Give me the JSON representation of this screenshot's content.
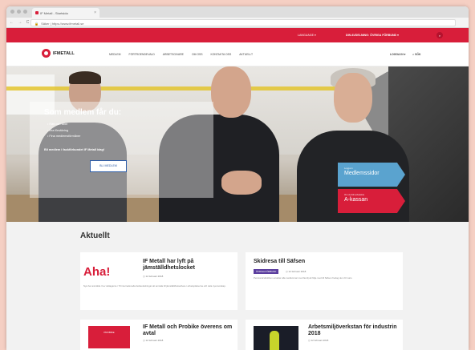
{
  "browser": {
    "tab_title": "IF Metall - Startsida",
    "url": "https://www.ifmetall.se",
    "url_prefix": "Säker",
    "nav_buttons": "← → C ⌂"
  },
  "utility": {
    "language": "LANGUAGE ▾",
    "association": "DIN AVDELNING: ÖVRIGA FÖRBUND ▾",
    "search_icon": "⌕"
  },
  "nav": {
    "logo": "IFMETALL",
    "links": [
      "MEDLEM",
      "FÖRTROENDEVALD",
      "ARBETSGIVARE",
      "OM OSS",
      "KONTAKTA OSS",
      "AKTUELLT"
    ],
    "login": "LOGGA IN ▾",
    "search": "⌕ SÖK"
  },
  "hero": {
    "title": "Som medlem får du:",
    "bullets": [
      "Rätt och stöd",
      "Bra försäkring",
      "Fina medlemsförmåner"
    ],
    "cta_text": "Bli medlem i fackförbundet IF Metall idag!",
    "button": "BLI MEDLEM",
    "arrow_blue_small": "Logga in",
    "arrow_blue": "Medlemssidor",
    "arrow_red_small": "Om du blir arbetslös",
    "arrow_red": "A-kassan"
  },
  "news": {
    "heading": "Aktuellt",
    "cards": [
      {
        "title": "IF Metall har lyft på jämställdhetslocket",
        "date": "◷ 12 februari 2018",
        "body": "Nya har anmälde 3 av deltagarna i 70 internationella fackavdelningar att anmäla till jämställdhetsarbete i arbetsplatserna och dela nya kunskap."
      },
      {
        "title": "Skidresa till Säfsen",
        "tag": "ÖVRIGA FÖRBUND",
        "date": "◷ 12 februari 2018",
        "body": "Pensionärsklubben avsaltar alla medlemmar med familj att följa med till Säfsen fredag den 23 mars."
      },
      {
        "title": "IF Metall och Probike överens om avtal",
        "date": "◷ 12 februari 2018",
        "thumb": "PROBIKE"
      },
      {
        "title": "Arbetsmiljöverkstan för industrin 2018",
        "date": "◷ 12 februari 2018"
      }
    ],
    "aha": "Aha!"
  }
}
